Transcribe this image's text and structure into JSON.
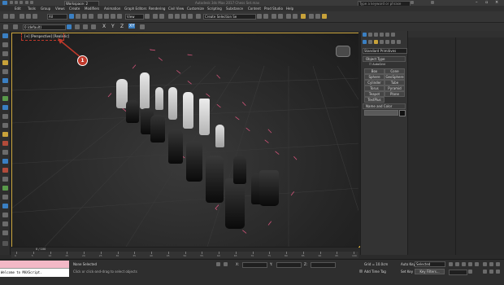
{
  "window": {
    "title_tab": "Workspace: 2",
    "search_placeholder": "Type a keyword or phrase",
    "title_center": "Autodesk 3ds Max 2017    Chess Set.max"
  },
  "menu": [
    "Edit",
    "Tools",
    "Group",
    "Views",
    "Create",
    "Modifiers",
    "Animation",
    "Graph Editors",
    "Rendering",
    "Civil View",
    "Customize",
    "Scripting",
    "Substance",
    "Content",
    "Prod Studio",
    "Help"
  ],
  "toolbar": {
    "undo_dropdown": "All",
    "view_dropdown": "View",
    "selection_set": "Create Selection Se"
  },
  "ribbon": {
    "layer_dropdown": "0 (default)"
  },
  "viewport": {
    "label": "[+] [Perspective] [Realistic]",
    "callout_number": "1"
  },
  "command_panel": {
    "category_dropdown": "Standard Primitives",
    "object_type_header": "Object Type",
    "autogrid_label": "AutoGrid",
    "buttons": [
      "Box",
      "Cone",
      "Sphere",
      "GeoSphere",
      "Cylinder",
      "Tube",
      "Torus",
      "Pyramid",
      "Teapot",
      "Plane",
      "TextPlus"
    ],
    "name_color_header": "Name and Color"
  },
  "timeline": {
    "frame_counter": "0 / 100",
    "ticks": [
      "0",
      "5",
      "10",
      "15",
      "20",
      "25",
      "30",
      "35",
      "40",
      "45",
      "50",
      "55",
      "60",
      "65",
      "70",
      "75",
      "80",
      "85",
      "90",
      "95",
      "100"
    ]
  },
  "status": {
    "listener_text": "Welcome to MAXScript.",
    "selection_status": "None Selected",
    "prompt": "Click or click-and-drag to select objects",
    "x_label": "X:",
    "y_label": "Y:",
    "z_label": "Z:",
    "grid": "Grid = 10.0cm",
    "add_time_tag": "Add Time Tag",
    "autokey": "Auto Key",
    "setkey": "Set Key",
    "selected_dropdown": "Selected",
    "key_filters": "Key Filters..."
  },
  "colors": {
    "accent_blue": "#3a7fc2",
    "callout_red": "#c0392b",
    "bbox_pink": "#d2547a",
    "listener_pink": "#f3b8c6"
  }
}
